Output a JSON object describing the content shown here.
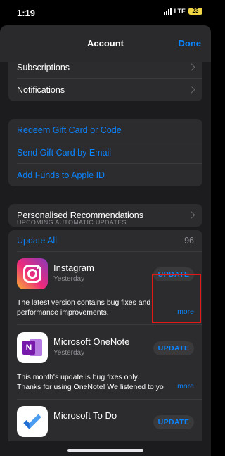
{
  "status_bar": {
    "time": "1:19",
    "network": "LTE",
    "battery": "23"
  },
  "nav": {
    "title": "Account",
    "done_label": "Done"
  },
  "account_rows": [
    {
      "label": "Subscriptions"
    },
    {
      "label": "Notifications"
    }
  ],
  "gift_rows": [
    {
      "label": "Redeem Gift Card or Code"
    },
    {
      "label": "Send Gift Card by Email"
    },
    {
      "label": "Add Funds to Apple ID"
    }
  ],
  "recommendations": {
    "label": "Personalised Recommendations"
  },
  "updates": {
    "section_header": "UPCOMING AUTOMATIC UPDATES",
    "update_all_label": "Update All",
    "count": "96",
    "apps": [
      {
        "name": "Instagram",
        "date": "Yesterday",
        "button": "UPDATE",
        "notes_line1": "The latest version contains bug fixes and",
        "notes_line2": "performance improvements.",
        "more": "more",
        "icon": "instagram-icon"
      },
      {
        "name": "Microsoft OneNote",
        "date": "Yesterday",
        "button": "UPDATE",
        "notes_line1": "This month's update is bug fixes only.",
        "notes_line2": "Thanks for using OneNote! We listened to yo",
        "more": "more",
        "icon": "onenote-icon",
        "icon_letter": "N"
      },
      {
        "name": "Microsoft To Do",
        "button": "UPDATE",
        "icon": "todo-icon"
      }
    ]
  },
  "colors": {
    "accent": "#0a84ff",
    "highlight": "#e11919",
    "background": "#1c1c1e",
    "cell": "#2c2c2e"
  }
}
